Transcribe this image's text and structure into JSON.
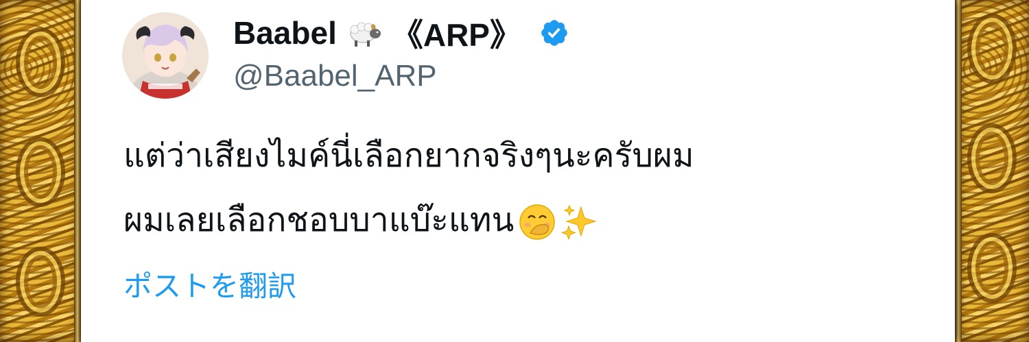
{
  "tweet": {
    "display_name": "Baabel",
    "name_decoration": "《ARP》",
    "handle": "@Baabel_ARP",
    "text_line_1": "แต่ว่าเสียงไมค์นี่เลือกยากจริงๆนะครับผม",
    "text_line_2": "ผมเลยเลือกชอบบาแบ๊ะแทน",
    "translate_label": "ポストを翻訳"
  },
  "icons": {
    "name_emoji": "sheep-icon",
    "verified_badge": "verified-badge-icon",
    "emoji_1": "hand-over-mouth-emoji-icon",
    "emoji_2": "sparkles-emoji-icon"
  },
  "colors": {
    "accent": "#1d9bf0",
    "handle_gray": "#536471",
    "text": "#0f1419",
    "frame_gold": "#e9b93a"
  }
}
